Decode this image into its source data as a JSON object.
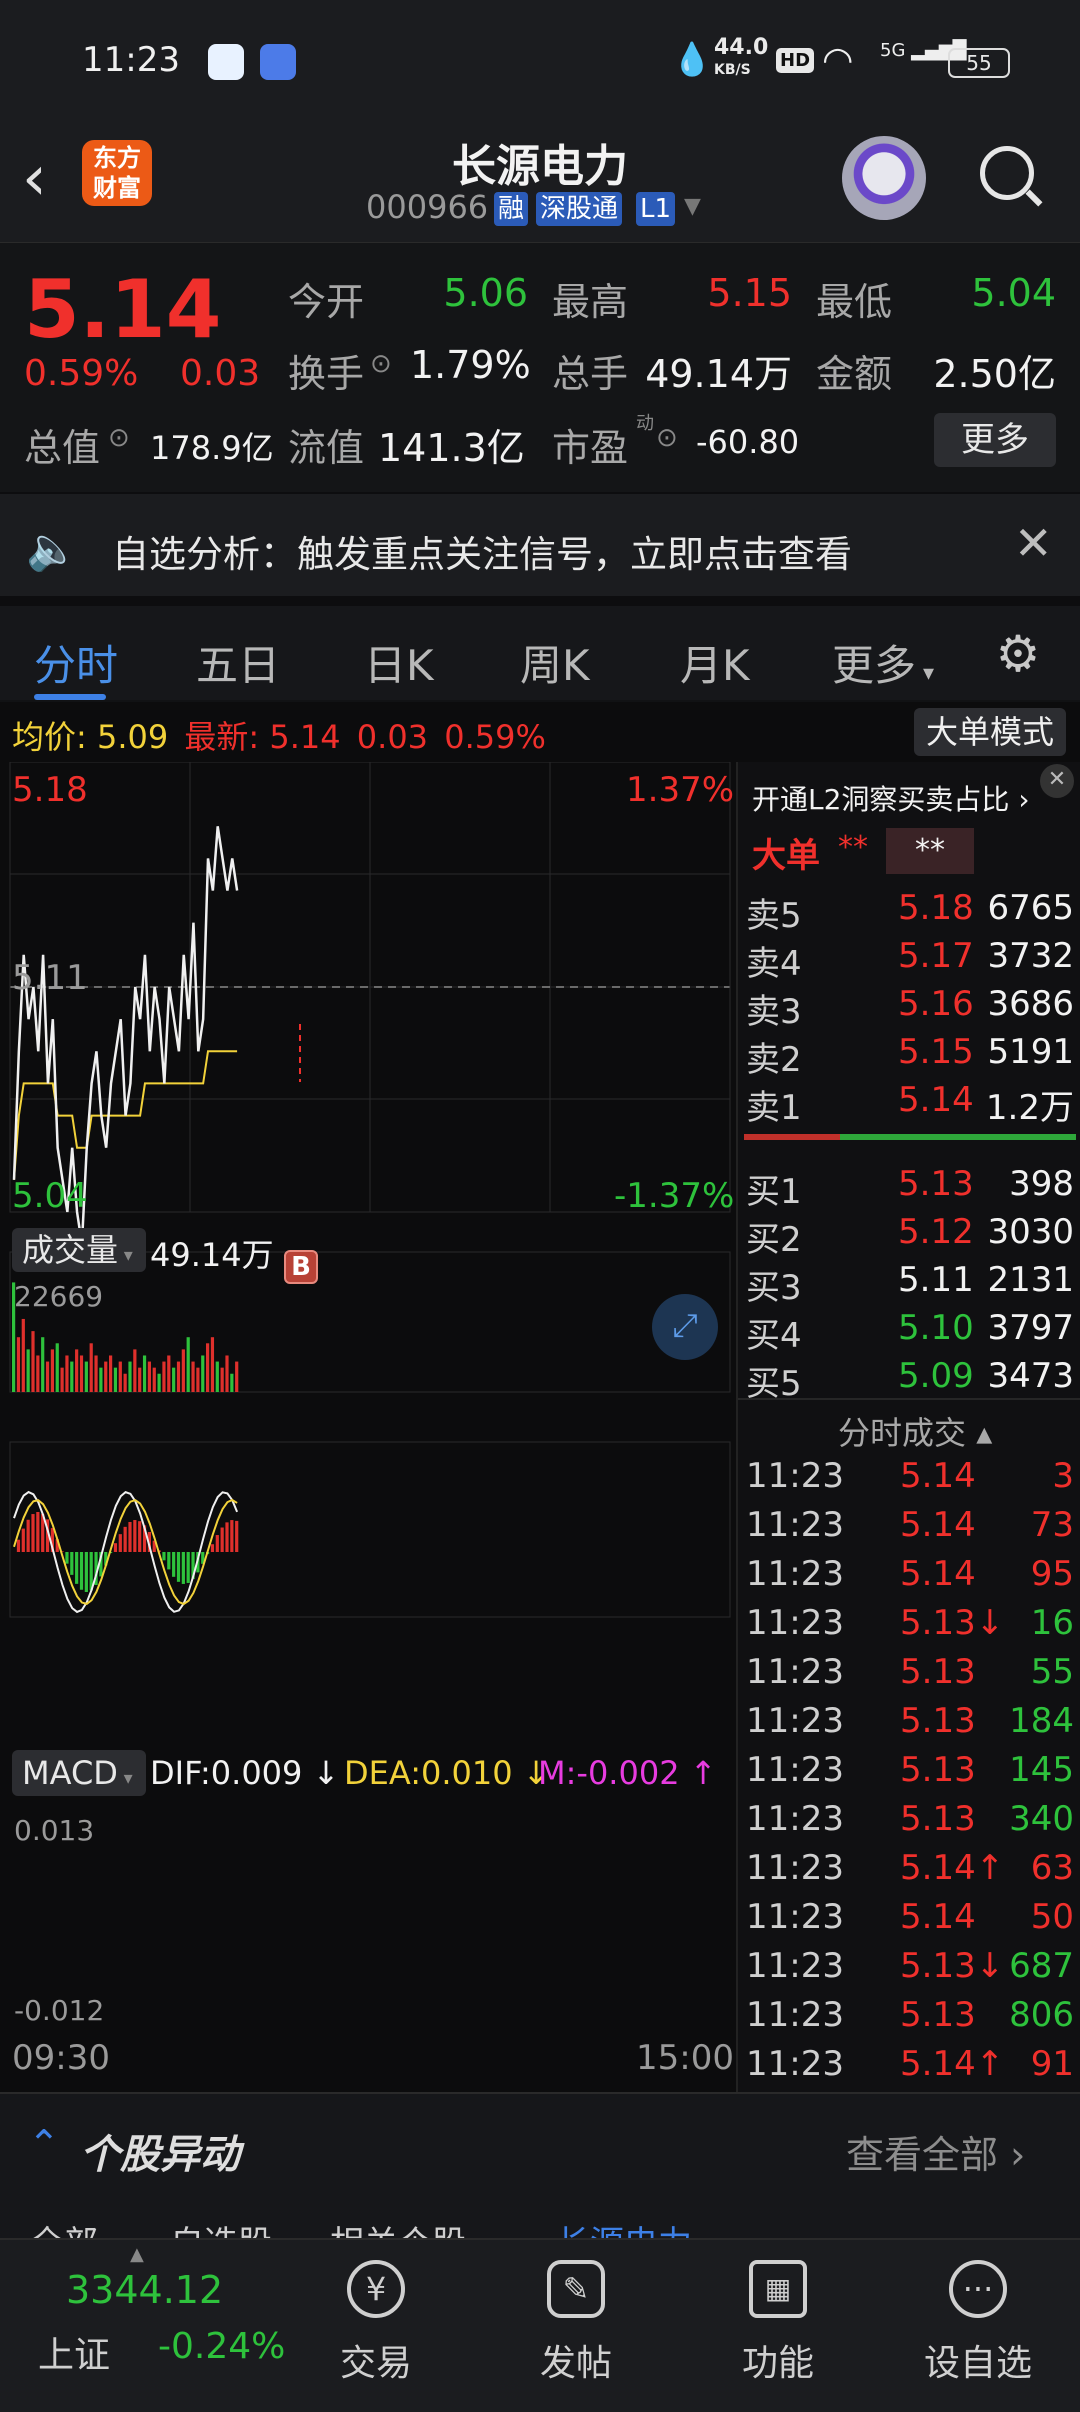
{
  "status": {
    "time": "11:23",
    "net_speed": "44.0",
    "net_unit": "KB/S",
    "hd": "HD",
    "signal": "5G",
    "battery": "55"
  },
  "header": {
    "logo_line1": "东方",
    "logo_line2": "财富",
    "name": "长源电力",
    "code": "000966",
    "tags": [
      "融",
      "深股通",
      "L1"
    ]
  },
  "quote": {
    "price": "5.14",
    "pct": "0.59%",
    "chg": "0.03",
    "open_label": "今开",
    "open": "5.06",
    "high_label": "最高",
    "high": "5.15",
    "low_label": "最低",
    "low": "5.04",
    "turnover_label": "换手",
    "turnover": "1.79%",
    "volume_label": "总手",
    "volume": "49.14万",
    "amount_label": "金额",
    "amount": "2.50亿",
    "mktcap_label": "总值",
    "mktcap": "178.9亿",
    "float_label": "流值",
    "float": "141.3亿",
    "pe_label": "市盈",
    "pe_sup": "动",
    "pe": "-60.80",
    "more": "更多"
  },
  "notice": {
    "text": "自选分析：触发重点关注信号，立即点击查看"
  },
  "tabs": [
    "分时",
    "五日",
    "日K",
    "周K",
    "月K",
    "更多"
  ],
  "avgbar": {
    "avg_label": "均价:",
    "avg": "5.09",
    "latest_label": "最新:",
    "latest": "5.14",
    "chg": "0.03",
    "pct": "0.59%",
    "mode_btn": "大单模式"
  },
  "chart": {
    "top_price": "5.18",
    "top_pct": "1.37%",
    "mid_price": "5.11",
    "bottom_price": "5.04",
    "bottom_pct": "-1.37%",
    "b_marker": "B",
    "vol_label": "成交量",
    "vol_value": "49.14万",
    "vol_max": "22669",
    "macd_label": "MACD",
    "dif": "DIF:0.009",
    "dea": "DEA:0.010",
    "m": "M:-0.002",
    "macd_top": "0.013",
    "macd_bottom": "-0.012",
    "time_start": "09:30",
    "time_end": "15:00"
  },
  "chart_data": {
    "type": "line",
    "title": "",
    "x_range": [
      "09:30",
      "15:00"
    ],
    "ylim": [
      5.04,
      5.18
    ],
    "series": [
      {
        "values": [
          5.05,
          5.09,
          5.12,
          5.1,
          5.11,
          5.09,
          5.12,
          5.08,
          5.1,
          5.06,
          5.05,
          5.04,
          5.06,
          5.04,
          5.03,
          5.06,
          5.08,
          5.09,
          5.07,
          5.06,
          5.08,
          5.09,
          5.1,
          5.07,
          5.08,
          5.11,
          5.1,
          5.12,
          5.09,
          5.11,
          5.1,
          5.08,
          5.11,
          5.1,
          5.09,
          5.12,
          5.1,
          5.13,
          5.09,
          5.1,
          5.15,
          5.14,
          5.16,
          5.15,
          5.14,
          5.15,
          5.14
        ]
      },
      {
        "values": [
          5.05,
          5.07,
          5.08,
          5.08,
          5.08,
          5.08,
          5.08,
          5.08,
          5.08,
          5.07,
          5.07,
          5.07,
          5.07,
          5.06,
          5.06,
          5.06,
          5.07,
          5.07,
          5.07,
          5.07,
          5.07,
          5.07,
          5.07,
          5.07,
          5.07,
          5.07,
          5.07,
          5.08,
          5.08,
          5.08,
          5.08,
          5.08,
          5.08,
          5.08,
          5.08,
          5.08,
          5.08,
          5.08,
          5.08,
          5.08,
          5.09,
          5.09,
          5.09,
          5.09,
          5.09,
          5.09,
          5.09
        ]
      }
    ],
    "volume": [
      18000,
      9000,
      12000,
      7000,
      10000,
      6000,
      9000,
      5000,
      7000,
      8000,
      4000,
      6000,
      5000,
      7000,
      6000,
      5000,
      8000,
      6000,
      4000,
      5000,
      6000,
      4000,
      5000,
      3000,
      5000,
      7000,
      4000,
      6000,
      5000,
      4000,
      3000,
      5000,
      6000,
      4000,
      5000,
      7000,
      9000,
      5000,
      4000,
      6000,
      8000,
      9000,
      5000,
      4000,
      6000,
      3000,
      5000
    ],
    "macd_ylim": [
      -0.012,
      0.013
    ]
  },
  "book": {
    "header": "开通L2洞察买卖占比",
    "big_label": "大单",
    "big_v1": "**",
    "big_v2": "**",
    "asks": [
      {
        "label": "卖5",
        "price": "5.18",
        "vol": "6765",
        "color": "red"
      },
      {
        "label": "卖4",
        "price": "5.17",
        "vol": "3732",
        "color": "red"
      },
      {
        "label": "卖3",
        "price": "5.16",
        "vol": "3686",
        "color": "red"
      },
      {
        "label": "卖2",
        "price": "5.15",
        "vol": "5191",
        "color": "red"
      },
      {
        "label": "卖1",
        "price": "5.14",
        "vol": "1.2万",
        "color": "red"
      }
    ],
    "bids": [
      {
        "label": "买1",
        "price": "5.13",
        "vol": "398",
        "color": "red"
      },
      {
        "label": "买2",
        "price": "5.12",
        "vol": "3030",
        "color": "red"
      },
      {
        "label": "买3",
        "price": "5.11",
        "vol": "2131",
        "color": "white"
      },
      {
        "label": "买4",
        "price": "5.10",
        "vol": "3797",
        "color": "green"
      },
      {
        "label": "买5",
        "price": "5.09",
        "vol": "3473",
        "color": "green"
      }
    ],
    "trades_label": "分时成交",
    "trades": [
      {
        "t": "11:23",
        "p": "5.14",
        "v": "3",
        "c": "red",
        "vc": "red"
      },
      {
        "t": "11:23",
        "p": "5.14",
        "v": "73",
        "c": "red",
        "vc": "red"
      },
      {
        "t": "11:23",
        "p": "5.14",
        "v": "95",
        "c": "red",
        "vc": "red"
      },
      {
        "t": "11:23",
        "p": "5.13↓",
        "v": "16",
        "c": "red",
        "vc": "green"
      },
      {
        "t": "11:23",
        "p": "5.13",
        "v": "55",
        "c": "red",
        "vc": "green"
      },
      {
        "t": "11:23",
        "p": "5.13",
        "v": "184",
        "c": "red",
        "vc": "green"
      },
      {
        "t": "11:23",
        "p": "5.13",
        "v": "145",
        "c": "red",
        "vc": "green"
      },
      {
        "t": "11:23",
        "p": "5.13",
        "v": "340",
        "c": "red",
        "vc": "green"
      },
      {
        "t": "11:23",
        "p": "5.14↑",
        "v": "63",
        "c": "red",
        "vc": "red"
      },
      {
        "t": "11:23",
        "p": "5.14",
        "v": "50",
        "c": "red",
        "vc": "red"
      },
      {
        "t": "11:23",
        "p": "5.13↓",
        "v": "687",
        "c": "red",
        "vc": "green"
      },
      {
        "t": "11:23",
        "p": "5.13",
        "v": "806",
        "c": "red",
        "vc": "green"
      },
      {
        "t": "11:23",
        "p": "5.14↑",
        "v": "91",
        "c": "red",
        "vc": "red"
      }
    ]
  },
  "movers": {
    "title": "个股异动",
    "view_all": "查看全部"
  },
  "subtabs": [
    "全部",
    "自选股",
    "相关个股",
    "长源电力"
  ],
  "bottomnav": {
    "index_value": "3344.12",
    "index_name": "上证",
    "index_pct": "-0.24%",
    "items": [
      "交易",
      "发帖",
      "功能",
      "设自选"
    ]
  },
  "colors": {
    "up": "#f0302c",
    "down": "#2ec23c",
    "accent": "#3d80e6",
    "avg_line": "#f2d23a"
  }
}
